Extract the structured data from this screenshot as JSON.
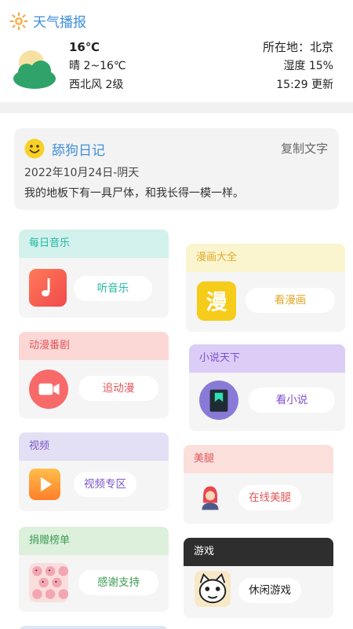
{
  "weather": {
    "title": "天气播报",
    "temperature": "16℃",
    "condition": "晴 2~16℃",
    "wind": "西北风 2级",
    "location": "所在地：北京",
    "humidity": "湿度 15%",
    "updated": "15:29 更新"
  },
  "diary": {
    "title": "舔狗日记",
    "copy_label": "复制文字",
    "date": "2022年10月24日-阴天",
    "text": "我的地板下有一具尸体，和我长得一模一样。"
  },
  "cards": {
    "music": {
      "header": "每日音乐",
      "button": "听音乐",
      "color": "#1fb8a2"
    },
    "comics": {
      "header": "漫画大全",
      "button": "看漫画",
      "color": "#e2a92a"
    },
    "anime": {
      "header": "动漫番剧",
      "button": "追动漫",
      "color": "#e0565a"
    },
    "novel": {
      "header": "小说天下",
      "button": "看小说",
      "color": "#7f4fd0"
    },
    "video": {
      "header": "视频",
      "button": "视频专区",
      "color": "#7b55c8"
    },
    "beauty": {
      "header": "美腿",
      "button": "在线美腿",
      "color": "#e0565a"
    },
    "donate": {
      "header": "捐赠榜单",
      "button": "感谢支持",
      "color": "#3f9d56"
    },
    "games": {
      "header": "游戏",
      "button": "休闲游戏",
      "color": "#222222"
    }
  },
  "icons": [
    "sun-icon",
    "cloud-sun-icon",
    "smiley-icon",
    "music-note-icon",
    "comic-icon",
    "video-camera-icon",
    "book-icon",
    "play-icon",
    "girl-avatar-icon",
    "kirby-pattern-icon",
    "cat-meme-icon"
  ]
}
